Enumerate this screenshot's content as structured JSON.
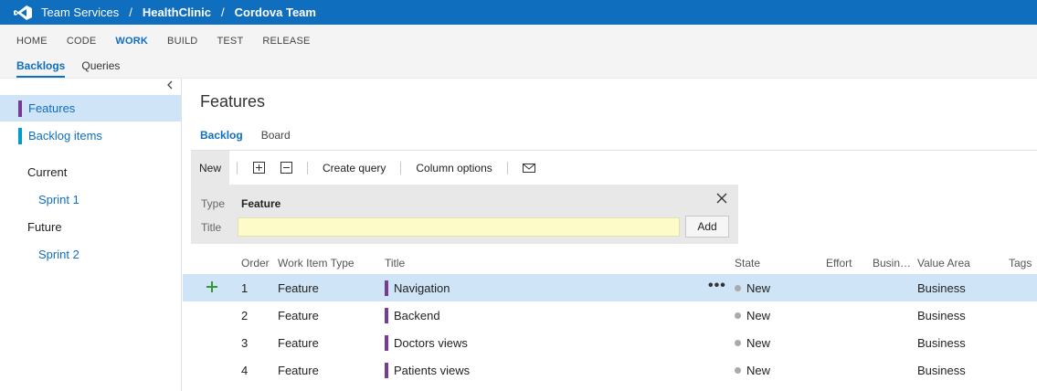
{
  "header": {
    "product": "Team Services",
    "project": "HealthClinic",
    "team": "Cordova Team",
    "separator": "/",
    "brand_color": "#106ebe"
  },
  "hub_nav": {
    "items": [
      {
        "label": "HOME"
      },
      {
        "label": "CODE"
      },
      {
        "label": "WORK",
        "active": true
      },
      {
        "label": "BUILD"
      },
      {
        "label": "TEST"
      },
      {
        "label": "RELEASE"
      }
    ],
    "sub_items": [
      {
        "label": "Backlogs",
        "active": true
      },
      {
        "label": "Queries"
      }
    ]
  },
  "sidebar": {
    "collapse_icon": "chevron-left-icon",
    "backlogs": [
      {
        "label": "Features",
        "color": "#773b93",
        "selected": true
      },
      {
        "label": "Backlog items",
        "color": "#009ccc"
      }
    ],
    "iterations": [
      {
        "group": "Current",
        "sprint": "Sprint 1"
      },
      {
        "group": "Future",
        "sprint": "Sprint 2"
      }
    ]
  },
  "main": {
    "title": "Features",
    "pivots": [
      {
        "label": "Backlog",
        "active": true
      },
      {
        "label": "Board"
      }
    ],
    "toolbar": {
      "new_label": "New",
      "expand_icon": "expand-all-icon",
      "collapse_icon": "collapse-all-icon",
      "create_query": "Create query",
      "column_options": "Column options",
      "email_icon": "email-icon"
    },
    "add_panel": {
      "type_label": "Type",
      "type_value": "Feature",
      "title_label": "Title",
      "title_value": "",
      "add_button": "Add"
    }
  },
  "grid": {
    "columns": {
      "order": "Order",
      "type": "Work Item Type",
      "title": "Title",
      "state": "State",
      "effort": "Effort",
      "business": "Busin…",
      "value_area": "Value Area",
      "tags": "Tags"
    },
    "rows": [
      {
        "order": "1",
        "type": "Feature",
        "title": "Navigation",
        "state": "New",
        "value_area": "Business",
        "selected": true
      },
      {
        "order": "2",
        "type": "Feature",
        "title": "Backend",
        "state": "New",
        "value_area": "Business"
      },
      {
        "order": "3",
        "type": "Feature",
        "title": "Doctors views",
        "state": "New",
        "value_area": "Business"
      },
      {
        "order": "4",
        "type": "Feature",
        "title": "Patients views",
        "state": "New",
        "value_area": "Business"
      }
    ],
    "feature_color": "#773b93",
    "state_new_color": "#aaaaaa",
    "add_icon": "plus-icon",
    "more_icon": "ellipsis-icon",
    "more_label": "•••"
  }
}
